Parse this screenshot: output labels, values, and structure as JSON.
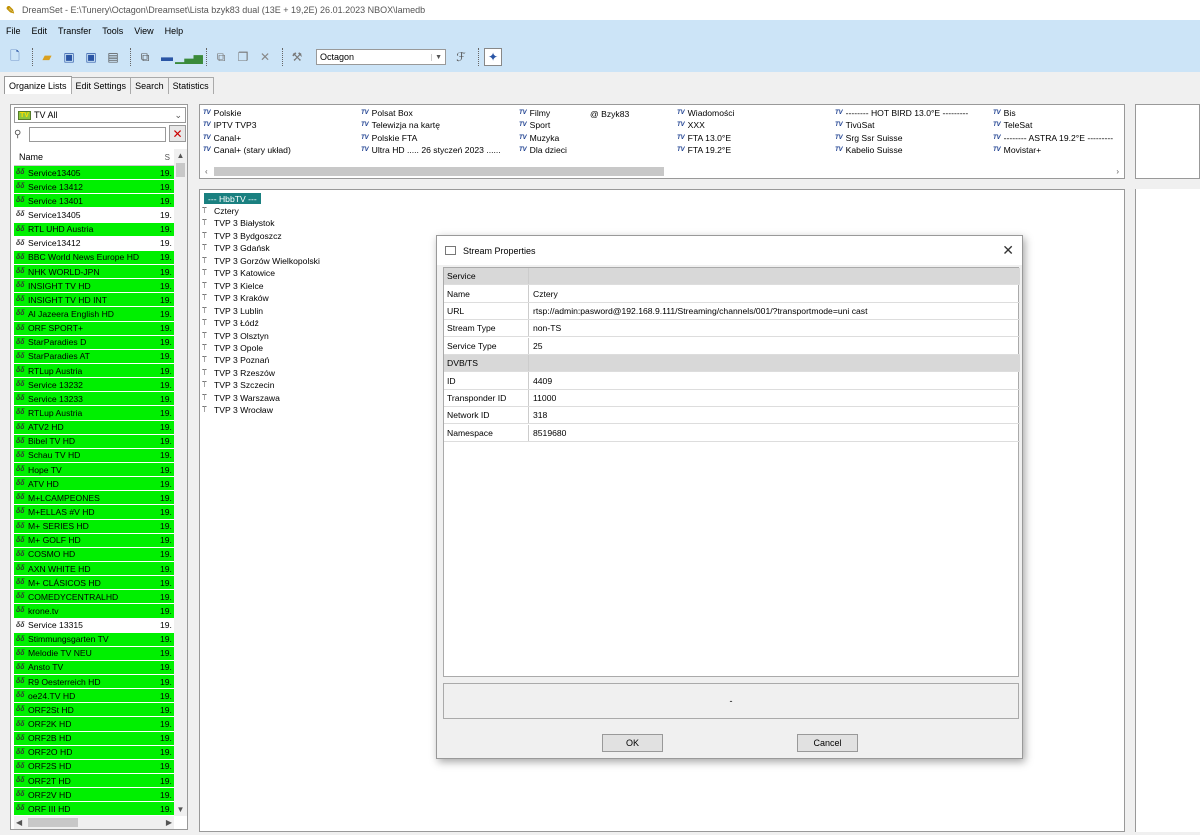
{
  "window": {
    "title": "DreamSet - E:\\Tunery\\Octagon\\Dreamset\\Lista bzyk83 dual (13E + 19,2E) 26.01.2023 NBOX\\lamedb"
  },
  "menu": [
    "File",
    "Edit",
    "Transfer",
    "Tools",
    "View",
    "Help"
  ],
  "toolbar": {
    "device": "Octagon"
  },
  "tabs": [
    "Organize Lists",
    "Edit Settings",
    "Search",
    "Statistics"
  ],
  "left": {
    "filter": "TV All",
    "search_value": "",
    "col_name": "Name",
    "col_sat": "S",
    "services": [
      {
        "name": "Service13405",
        "sat": "19.",
        "hl": true
      },
      {
        "name": "Service 13412",
        "sat": "19.",
        "hl": true
      },
      {
        "name": "Service 13401",
        "sat": "19.",
        "hl": true
      },
      {
        "name": "Service13405",
        "sat": "19.",
        "hl": false
      },
      {
        "name": "RTL UHD Austria",
        "sat": "19.",
        "hl": true
      },
      {
        "name": "Service13412",
        "sat": "19.",
        "hl": false
      },
      {
        "name": "BBC World News Europe HD",
        "sat": "19.",
        "hl": true
      },
      {
        "name": "NHK WORLD-JPN",
        "sat": "19.",
        "hl": true
      },
      {
        "name": "INSIGHT TV HD",
        "sat": "19.",
        "hl": true
      },
      {
        "name": "INSIGHT TV HD INT",
        "sat": "19.",
        "hl": true
      },
      {
        "name": "Al Jazeera English HD",
        "sat": "19.",
        "hl": true
      },
      {
        "name": "ORF SPORT+",
        "sat": "19.",
        "hl": true
      },
      {
        "name": "StarParadies D",
        "sat": "19.",
        "hl": true
      },
      {
        "name": "StarParadies AT",
        "sat": "19.",
        "hl": true
      },
      {
        "name": "RTLup Austria",
        "sat": "19.",
        "hl": true
      },
      {
        "name": "Service 13232",
        "sat": "19.",
        "hl": true
      },
      {
        "name": "Service 13233",
        "sat": "19.",
        "hl": true
      },
      {
        "name": "RTLup Austria",
        "sat": "19.",
        "hl": true
      },
      {
        "name": "ATV2 HD",
        "sat": "19.",
        "hl": true
      },
      {
        "name": "Bibel TV HD",
        "sat": "19.",
        "hl": true
      },
      {
        "name": "Schau TV HD",
        "sat": "19.",
        "hl": true
      },
      {
        "name": "Hope TV",
        "sat": "19.",
        "hl": true
      },
      {
        "name": "ATV HD",
        "sat": "19.",
        "hl": true
      },
      {
        "name": "M+LCAMPEONES",
        "sat": "19.",
        "hl": true
      },
      {
        "name": "M+ELLAS #V HD",
        "sat": "19.",
        "hl": true
      },
      {
        "name": "M+ SERIES HD",
        "sat": "19.",
        "hl": true
      },
      {
        "name": "M+ GOLF HD",
        "sat": "19.",
        "hl": true
      },
      {
        "name": "COSMO HD",
        "sat": "19.",
        "hl": true
      },
      {
        "name": "AXN WHITE HD",
        "sat": "19.",
        "hl": true
      },
      {
        "name": "M+ CLÁSICOS HD",
        "sat": "19.",
        "hl": true
      },
      {
        "name": "COMEDYCENTRALHD",
        "sat": "19.",
        "hl": true
      },
      {
        "name": "krone.tv",
        "sat": "19.",
        "hl": true
      },
      {
        "name": "Service 13315",
        "sat": "19.",
        "hl": false
      },
      {
        "name": "Stimmungsgarten TV",
        "sat": "19.",
        "hl": true
      },
      {
        "name": "Melodie TV NEU",
        "sat": "19.",
        "hl": true
      },
      {
        "name": "Ansto TV",
        "sat": "19.",
        "hl": true
      },
      {
        "name": "R9 Oesterreich HD",
        "sat": "19.",
        "hl": true
      },
      {
        "name": "oe24.TV HD",
        "sat": "19.",
        "hl": true
      },
      {
        "name": "ORF2St HD",
        "sat": "19.",
        "hl": true
      },
      {
        "name": "ORF2K HD",
        "sat": "19.",
        "hl": true
      },
      {
        "name": "ORF2B HD",
        "sat": "19.",
        "hl": true
      },
      {
        "name": "ORF2O HD",
        "sat": "19.",
        "hl": true
      },
      {
        "name": "ORF2S HD",
        "sat": "19.",
        "hl": true
      },
      {
        "name": "ORF2T HD",
        "sat": "19.",
        "hl": true
      },
      {
        "name": "ORF2V HD",
        "sat": "19.",
        "hl": true
      },
      {
        "name": "ORF III HD",
        "sat": "19.",
        "hl": true
      }
    ]
  },
  "bouquets": [
    [
      "Polskie",
      "IPTV TVP3",
      "Canal+",
      "Canal+ (stary układ)"
    ],
    [
      "Polsat Box",
      "Telewizja na kartę",
      "Polskie FTA",
      "Ultra HD ..... 26 styczeń 2023 ......"
    ],
    [
      "Filmy",
      "Sport",
      "Muzyka",
      "Dla dzieci"
    ],
    [
      "Wiadomości",
      "XXX",
      "FTA 13.0°E",
      "FTA 19.2°E"
    ],
    [
      "-------- HOT BIRD 13.0°E ---------",
      "TivùSat",
      "Srg Ssr Suisse",
      "Kabelio Suisse"
    ],
    [
      "Bis",
      "TeleSat",
      "-------- ASTRA 19.2°E ---------",
      "Movistar+"
    ]
  ],
  "bouquet_extra": "@ Bzyk83",
  "channels": {
    "header": "--- HbbTV ---",
    "items": [
      "Cztery",
      "TVP 3 Białystok",
      "TVP 3 Bydgoszcz",
      "TVP 3 Gdańsk",
      "TVP 3 Gorzów Wielkopolski",
      "TVP 3 Katowice",
      "TVP 3 Kielce",
      "TVP 3 Kraków",
      "TVP 3 Lublin",
      "TVP 3 Łódź",
      "TVP 3 Olsztyn",
      "TVP 3 Opole",
      "TVP 3 Poznań",
      "TVP 3 Rzeszów",
      "TVP 3 Szczecin",
      "TVP 3 Warszawa",
      "TVP 3 Wrocław"
    ]
  },
  "dialog": {
    "title": "Stream Properties",
    "rows": [
      {
        "k": "Service",
        "v": "",
        "hdr": true
      },
      {
        "k": "Name",
        "v": "Cztery"
      },
      {
        "k": "URL",
        "v": "rtsp://admin:pasword@192.168.9.111/Streaming/channels/001/?transportmode=uni cast"
      },
      {
        "k": "Stream Type",
        "v": "non-TS"
      },
      {
        "k": "Service Type",
        "v": "25"
      },
      {
        "k": "DVB/TS",
        "v": "",
        "hdr": true
      },
      {
        "k": "ID",
        "v": "4409"
      },
      {
        "k": "Transponder ID",
        "v": "11000"
      },
      {
        "k": "Network ID",
        "v": "318"
      },
      {
        "k": "Namespace",
        "v": "8519680"
      }
    ],
    "description": "-",
    "ok": "OK",
    "cancel": "Cancel"
  }
}
